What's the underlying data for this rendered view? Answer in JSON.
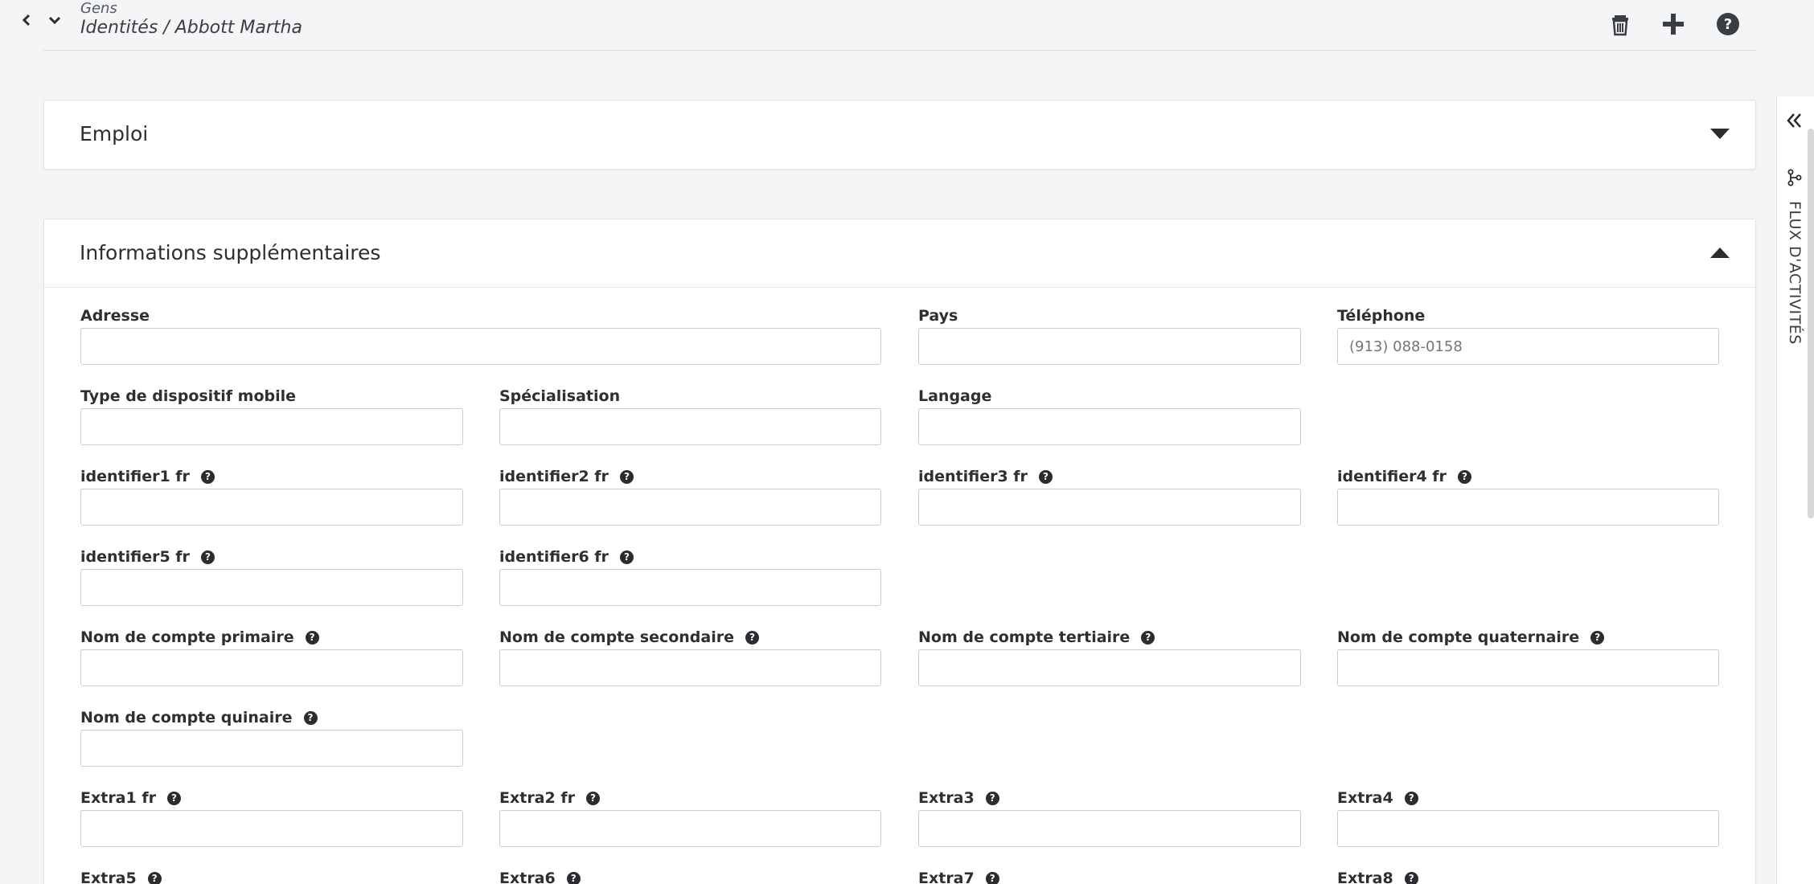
{
  "header": {
    "breadcrumb_parent": "Gens",
    "breadcrumb_path": "Identités / Abbott Martha",
    "icons": [
      "chevron-left-icon",
      "chevron-down-icon",
      "trash-icon",
      "plus-icon",
      "help-circle-icon"
    ]
  },
  "sections": {
    "employment": {
      "title": "Emploi",
      "expanded": false
    },
    "additional": {
      "title": "Informations supplémentaires",
      "expanded": true
    }
  },
  "fields": {
    "address": {
      "label": "Adresse",
      "value": ""
    },
    "country": {
      "label": "Pays",
      "value": ""
    },
    "phone": {
      "label": "Téléphone",
      "placeholder": "(913) 088-0158",
      "value": ""
    },
    "mobile_device_type": {
      "label": "Type de dispositif mobile",
      "value": ""
    },
    "specialization": {
      "label": "Spécialisation",
      "value": ""
    },
    "language": {
      "label": "Langage",
      "value": ""
    },
    "identifier1": {
      "label": "identifier1 fr",
      "value": ""
    },
    "identifier2": {
      "label": "identifier2 fr",
      "value": ""
    },
    "identifier3": {
      "label": "identifier3 fr",
      "value": ""
    },
    "identifier4": {
      "label": "identifier4 fr",
      "value": ""
    },
    "identifier5": {
      "label": "identifier5 fr",
      "value": ""
    },
    "identifier6": {
      "label": "identifier6 fr",
      "value": ""
    },
    "account_primary": {
      "label": "Nom de compte primaire",
      "value": ""
    },
    "account_secondary": {
      "label": "Nom de compte secondaire",
      "value": ""
    },
    "account_tertiary": {
      "label": "Nom de compte tertiaire",
      "value": ""
    },
    "account_quaternary": {
      "label": "Nom de compte quaternaire",
      "value": ""
    },
    "account_quinary": {
      "label": "Nom de compte quinaire",
      "value": ""
    },
    "extra1": {
      "label": "Extra1 fr",
      "value": ""
    },
    "extra2": {
      "label": "Extra2 fr",
      "value": ""
    },
    "extra3": {
      "label": "Extra3",
      "value": ""
    },
    "extra4": {
      "label": "Extra4",
      "value": ""
    },
    "extra5": {
      "label": "Extra5",
      "value": ""
    },
    "extra6": {
      "label": "Extra6",
      "value": ""
    },
    "extra7": {
      "label": "Extra7",
      "value": ""
    },
    "extra8": {
      "label": "Extra8",
      "value": ""
    }
  },
  "help_glyph": "?",
  "side_panel": {
    "activity_feed_label": "FLUX D'ACTIVITÉS"
  }
}
